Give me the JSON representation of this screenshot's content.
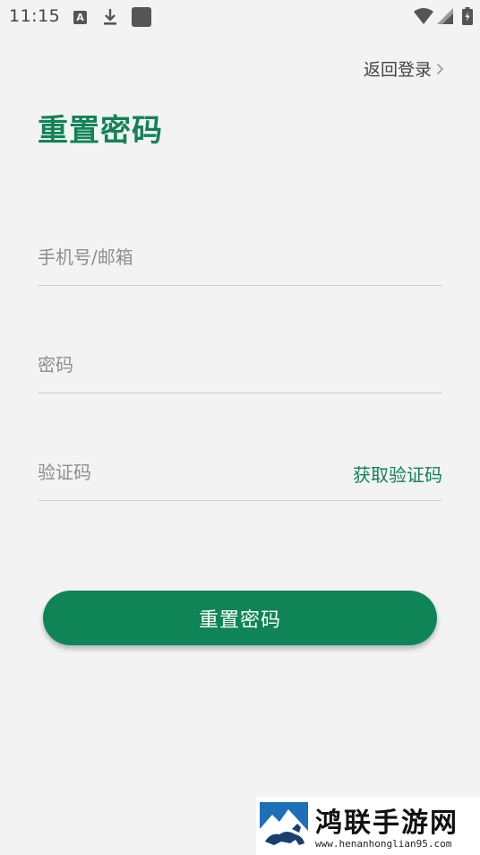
{
  "status_bar": {
    "time": "11:15",
    "left_icons": [
      "a-notification-icon",
      "download-icon",
      "square-notification-icon"
    ],
    "right_icons": [
      "wifi-icon",
      "signal-icon",
      "battery-icon"
    ],
    "a_icon_letter": "A"
  },
  "header": {
    "back_login_label": "返回登录",
    "title": "重置密码"
  },
  "form": {
    "phone_placeholder": "手机号/邮箱",
    "phone_value": "",
    "password_placeholder": "密码",
    "password_value": "",
    "code_placeholder": "验证码",
    "code_value": "",
    "get_code_label": "获取验证码",
    "submit_label": "重置密码"
  },
  "watermark": {
    "brand": "鸿联手游网",
    "url": "www.henanhonglian95.com"
  },
  "colors": {
    "accent": "#128257",
    "button": "#0f8457",
    "background": "#f3f3f3",
    "divider": "#cfcfcf",
    "placeholder": "#8e8e8e"
  }
}
